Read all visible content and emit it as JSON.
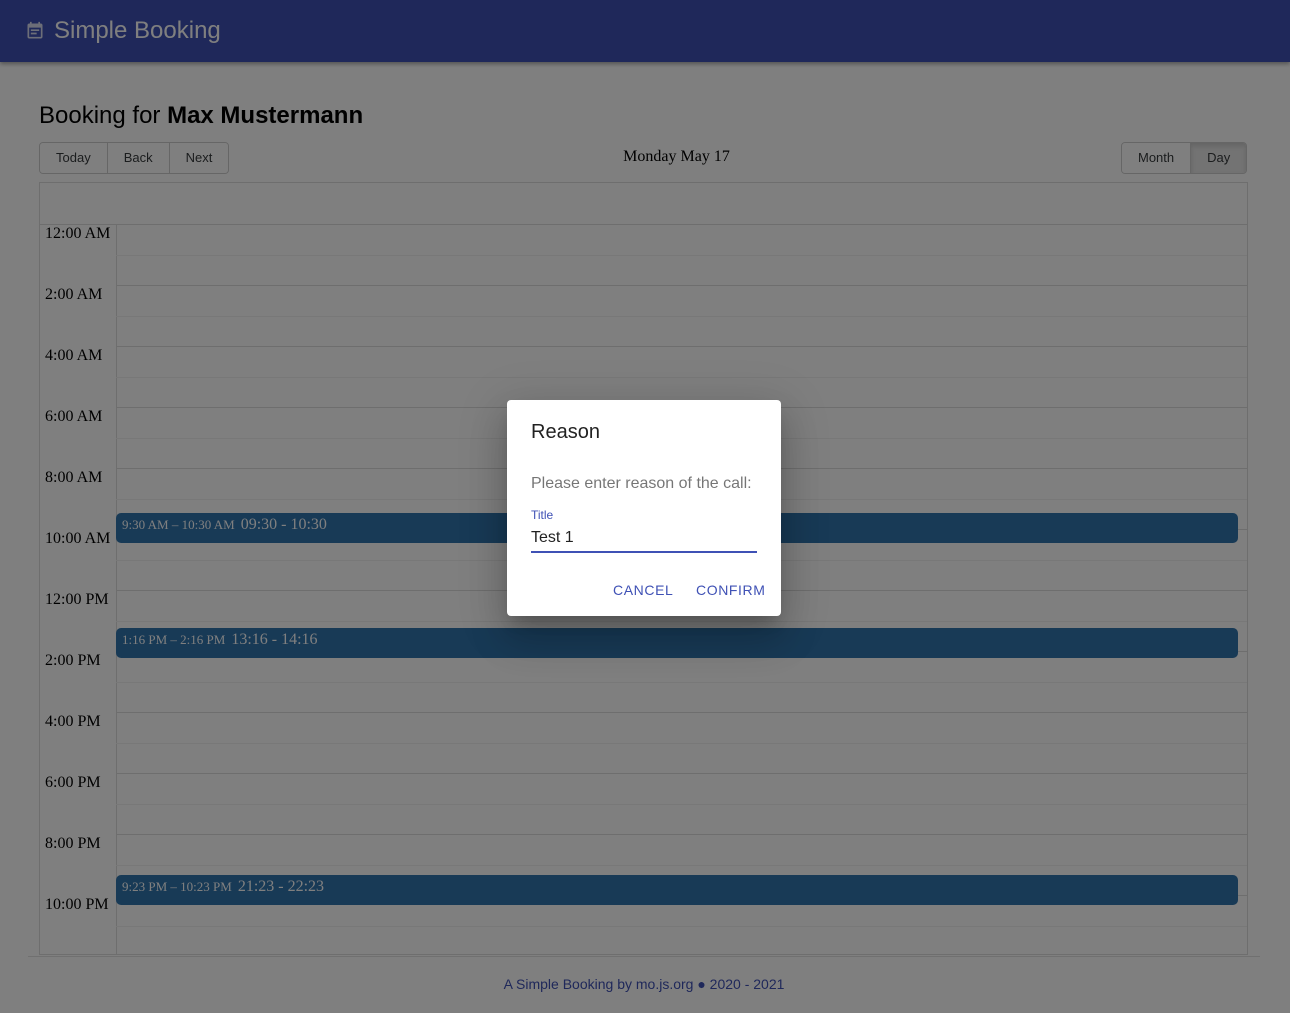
{
  "app": {
    "title": "Simple Booking",
    "icon": "calendar-note-icon",
    "bar_color": "#3f51b5"
  },
  "booking": {
    "prefix": "Booking for",
    "name": "Max Mustermann"
  },
  "toolbar": {
    "today_label": "Today",
    "back_label": "Back",
    "next_label": "Next",
    "date_label": "Monday May 17",
    "month_label": "Month",
    "day_label": "Day",
    "active_view": "Day"
  },
  "time_labels": [
    "12:00 AM",
    "2:00 AM",
    "4:00 AM",
    "6:00 AM",
    "8:00 AM",
    "10:00 AM",
    "12:00 PM",
    "2:00 PM",
    "4:00 PM",
    "6:00 PM",
    "8:00 PM",
    "10:00 PM"
  ],
  "events": [
    {
      "time": "9:30 AM – 10:30 AM",
      "title": "09:30 - 10:30",
      "start_hour": 9.5
    },
    {
      "time": "1:16 PM – 2:16 PM",
      "title": "13:16 - 14:16",
      "start_hour": 13.27
    },
    {
      "time": "9:23 PM – 10:23 PM",
      "title": "21:23 - 22:23",
      "start_hour": 21.38
    }
  ],
  "event_color": "#3174ad",
  "footer": {
    "text": "A Simple Booking by mo.js.org ● 2020 - 2021"
  },
  "dialog": {
    "title": "Reason",
    "text": "Please enter reason of the call:",
    "field_label": "Title",
    "field_value": "Test 1",
    "cancel_label": "CANCEL",
    "confirm_label": "CONFIRM"
  }
}
